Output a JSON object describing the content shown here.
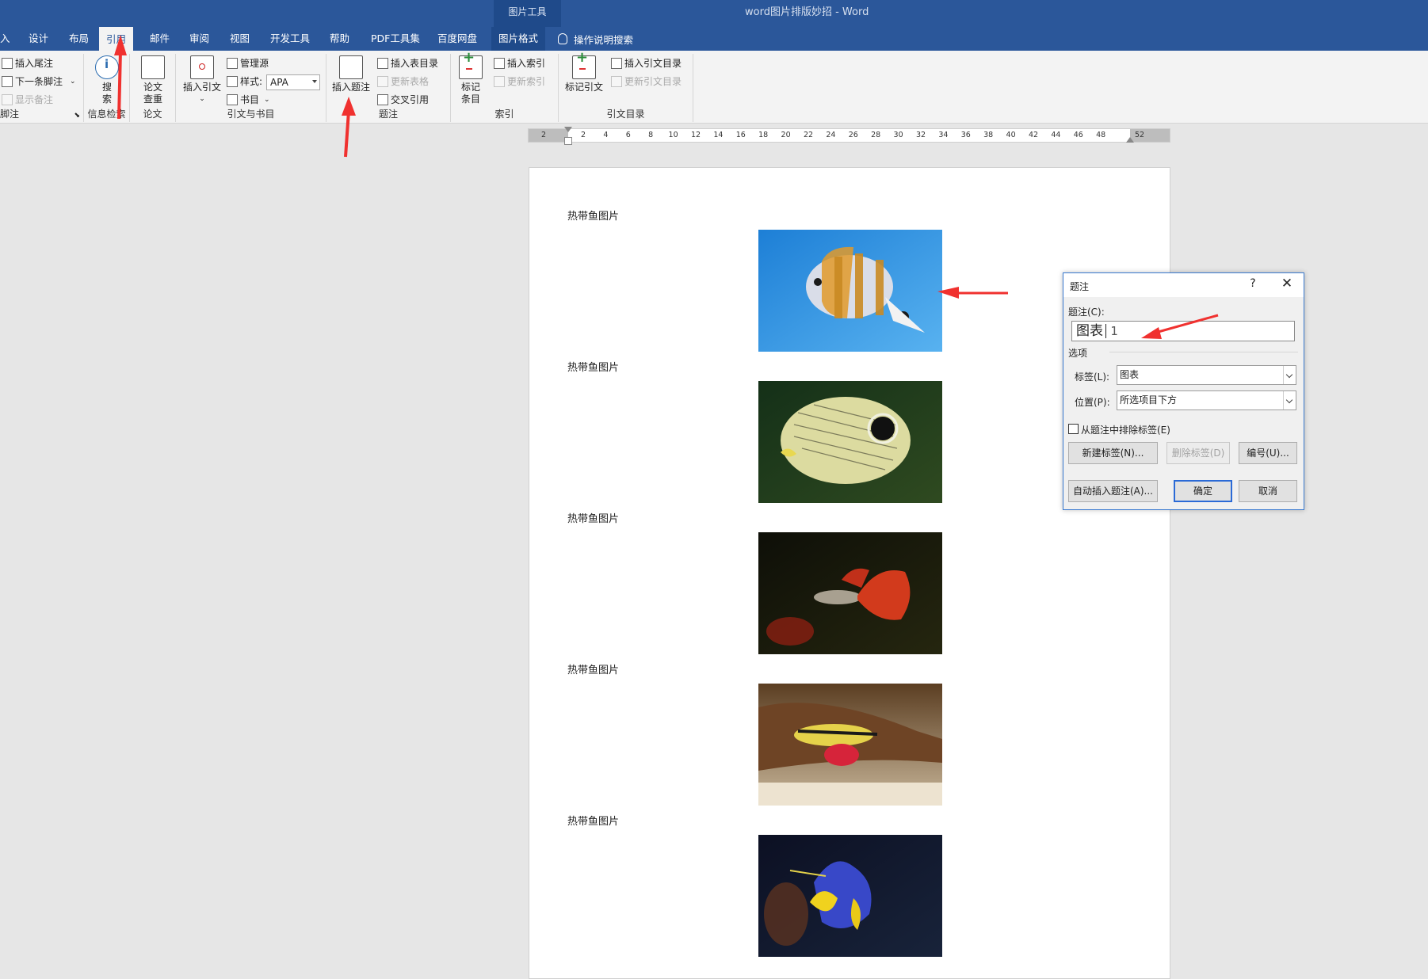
{
  "title_bar": {
    "context_tab_title": "图片工具",
    "window_title": "word图片排版妙招  -  Word"
  },
  "tabs": [
    {
      "label": "入"
    },
    {
      "label": "设计"
    },
    {
      "label": "布局"
    },
    {
      "label": "引用",
      "active": true
    },
    {
      "label": "邮件"
    },
    {
      "label": "审阅"
    },
    {
      "label": "视图"
    },
    {
      "label": "开发工具"
    },
    {
      "label": "帮助"
    },
    {
      "label": "PDF工具集"
    },
    {
      "label": "百度网盘"
    },
    {
      "label": "图片格式"
    }
  ],
  "tell_me": "操作说明搜索",
  "ribbon": {
    "footnotes": {
      "insert_endnote": "插入尾注",
      "next_footnote": "下一条脚注",
      "show_notes": "显示备注",
      "group": "脚注"
    },
    "research": {
      "search_line1": "搜",
      "search_line2": "索",
      "group": "信息检索"
    },
    "paper": {
      "check_line1": "论文",
      "check_line2": "查重",
      "group": "论文"
    },
    "citations": {
      "insert_citation": "插入引文",
      "manage_sources": "管理源",
      "style_label": "样式:",
      "style_value": "APA",
      "bibliography": "书目",
      "group": "引文与书目"
    },
    "captions": {
      "insert_caption": "插入题注",
      "insert_table_of_figures": "插入表目录",
      "update_table": "更新表格",
      "cross_reference": "交叉引用",
      "group": "题注"
    },
    "index": {
      "mark_entry_line1": "标记",
      "mark_entry_line2": "条目",
      "insert_index": "插入索引",
      "update_index": "更新索引",
      "group": "索引"
    },
    "table_of_authorities": {
      "mark_citation": "标记引文",
      "insert_toa": "插入引文目录",
      "update_toa": "更新引文目录",
      "group": "引文目录"
    }
  },
  "ruler": {
    "numbers": [
      "2",
      "2",
      "4",
      "6",
      "8",
      "10",
      "12",
      "14",
      "16",
      "18",
      "20",
      "22",
      "24",
      "26",
      "28",
      "30",
      "32",
      "34",
      "36",
      "38",
      "40",
      "42",
      "44",
      "46",
      "48",
      "52"
    ]
  },
  "document": {
    "captions": [
      "热带鱼图片",
      "热带鱼图片",
      "热带鱼图片",
      "热带鱼图片",
      "热带鱼图片"
    ],
    "images": [
      {
        "icon": "butterflyfish-image",
        "colors": [
          "#1d7fd6",
          "#58b2f0"
        ]
      },
      {
        "icon": "foureye-butterflyfish-image",
        "colors": [
          "#143018",
          "#2f4a20"
        ]
      },
      {
        "icon": "guppy-image",
        "colors": [
          "#0e0f08",
          "#25260f"
        ]
      },
      {
        "icon": "cichlid-image",
        "colors": [
          "#5b3e22",
          "#c9b79a"
        ]
      },
      {
        "icon": "angelfish-image",
        "colors": [
          "#0c1023",
          "#18233a"
        ]
      }
    ]
  },
  "dialog": {
    "title": "题注",
    "help": "?",
    "close": "✕",
    "caption_label": "题注(C):",
    "caption_value": "图表",
    "caption_number": "1",
    "options_label": "选项",
    "label_field": "标签(L):",
    "label_value": "图表",
    "position_field": "位置(P):",
    "position_value": "所选项目下方",
    "exclude_label": "从题注中排除标签(E)",
    "new_label": "新建标签(N)...",
    "delete_label": "删除标签(D)",
    "numbering": "编号(U)...",
    "auto_caption": "自动插入题注(A)...",
    "ok": "确定",
    "cancel": "取消"
  },
  "colors": {
    "ribbon_blue": "#2b579a",
    "annotation_red": "#f0312f",
    "dialog_border": "#3a7ad0"
  }
}
